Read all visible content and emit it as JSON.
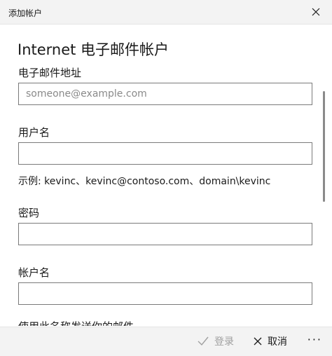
{
  "window": {
    "title": "添加帐户",
    "close_icon": "close-icon"
  },
  "form": {
    "heading": "Internet 电子邮件帐户",
    "email_label": "电子邮件地址",
    "email_placeholder": "someone@example.com",
    "email_value": "",
    "username_label": "用户名",
    "username_value": "",
    "username_example": "示例: kevinc、kevinc@contoso.com、domain\\kevinc",
    "password_label": "密码",
    "password_value": "",
    "account_name_label": "帐户名",
    "account_name_value": "",
    "send_name_label": "使用此名称发送你的邮件"
  },
  "footer": {
    "signin_label": "登录",
    "signin_icon": "checkmark-icon",
    "cancel_label": "取消",
    "cancel_icon": "close-icon",
    "more_label": "···",
    "more_icon": "more-icon"
  },
  "colors": {
    "chrome": "#f3f3f3",
    "border": "#7a7a7a",
    "disabled": "#a0a0a0"
  }
}
